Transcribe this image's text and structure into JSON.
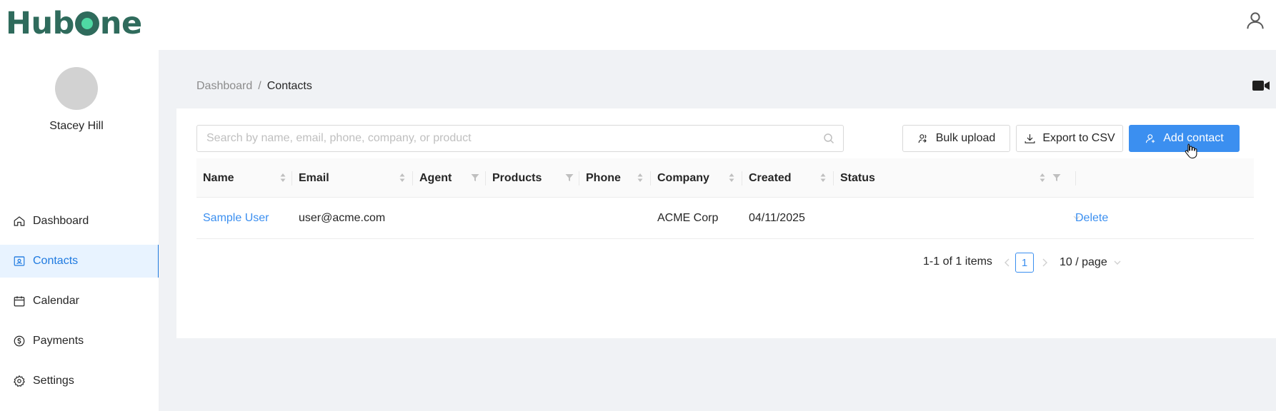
{
  "app": {
    "logo_text_pre": "Hub",
    "logo_text_post": "ne",
    "brand_color": "#2f6b5c",
    "accent_color": "#3b8ff0",
    "user_icon": "user-icon"
  },
  "sidebar": {
    "user_name": "Stacey Hill",
    "items": [
      {
        "label": "Dashboard",
        "icon": "home-icon",
        "active": false
      },
      {
        "label": "Contacts",
        "icon": "contacts-icon",
        "active": true
      },
      {
        "label": "Calendar",
        "icon": "calendar-icon",
        "active": false
      },
      {
        "label": "Payments",
        "icon": "dollar-circle-icon",
        "active": false
      },
      {
        "label": "Settings",
        "icon": "gear-icon",
        "active": false
      }
    ]
  },
  "breadcrumb": {
    "parent": "Dashboard",
    "separator": "/",
    "current": "Contacts"
  },
  "toolbar": {
    "search_placeholder": "Search by name, email, phone, company, or product",
    "search_value": "",
    "bulk_upload_label": "Bulk upload",
    "export_label": "Export to CSV",
    "add_contact_label": "Add contact"
  },
  "table": {
    "columns": [
      {
        "label": "Name",
        "control": "sort"
      },
      {
        "label": "Email",
        "control": "sort"
      },
      {
        "label": "Agent",
        "control": "filter"
      },
      {
        "label": "Products",
        "control": "filter"
      },
      {
        "label": "Phone",
        "control": "sort"
      },
      {
        "label": "Company",
        "control": "sort"
      },
      {
        "label": "Created",
        "control": "sort"
      },
      {
        "label": "Status",
        "control": "sort+filter"
      }
    ],
    "rows": [
      {
        "name": "Sample User",
        "email": "user@acme.com",
        "agent": "",
        "products": "",
        "phone": "",
        "company": "ACME Corp",
        "created": "04/11/2025",
        "status": "",
        "action": "Delete"
      }
    ]
  },
  "pagination": {
    "total_text": "1-1 of 1 items",
    "current_page": "1",
    "page_size": "10 / page"
  }
}
